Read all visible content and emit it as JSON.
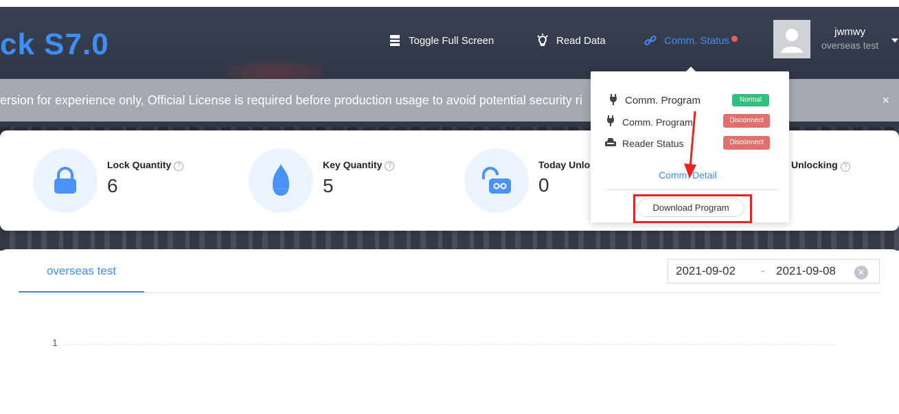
{
  "app": {
    "title": "ck S7.0"
  },
  "topnav": {
    "fullscreen_label": "Toggle Full Screen",
    "readdata_label": "Read Data",
    "comm_status_label": "Comm. Status"
  },
  "user": {
    "name": "jwmwy",
    "org": "overseas test"
  },
  "notice": {
    "text": "ersion for experience only, Official License is required before production usage to avoid potential security ri",
    "close_label": "×"
  },
  "stats": {
    "lock": {
      "label": "Lock Quantity",
      "value": "6",
      "icon": "lock-icon"
    },
    "key": {
      "label": "Key Quantity",
      "value": "5",
      "icon": "key-icon"
    },
    "today": {
      "label": "Today Unlo",
      "value": "0",
      "icon": "unlock-icon"
    },
    "unlocking_label": "Unlocking",
    "help_symbol": "?"
  },
  "popover": {
    "rows": [
      {
        "label": "Comm. Program",
        "status": "Normal",
        "icon": "plug-icon"
      },
      {
        "label": "Comm. Program",
        "status": "Disconnect",
        "icon": "plug-icon"
      },
      {
        "label": "Reader Status",
        "status": "Disconnect",
        "icon": "reader-icon"
      }
    ],
    "detail_link": "Comm. Detail",
    "download_button": "Download Program"
  },
  "panel": {
    "tab_label": "overseas test",
    "date_start": "2021-09-02",
    "date_sep": "-",
    "date_end": "2021-09-08",
    "chart_tick": "1"
  },
  "colors": {
    "accent": "#3d8ef5",
    "normal": "#2fc07f",
    "disconnect": "#e0706d",
    "annotation": "#e52424"
  }
}
